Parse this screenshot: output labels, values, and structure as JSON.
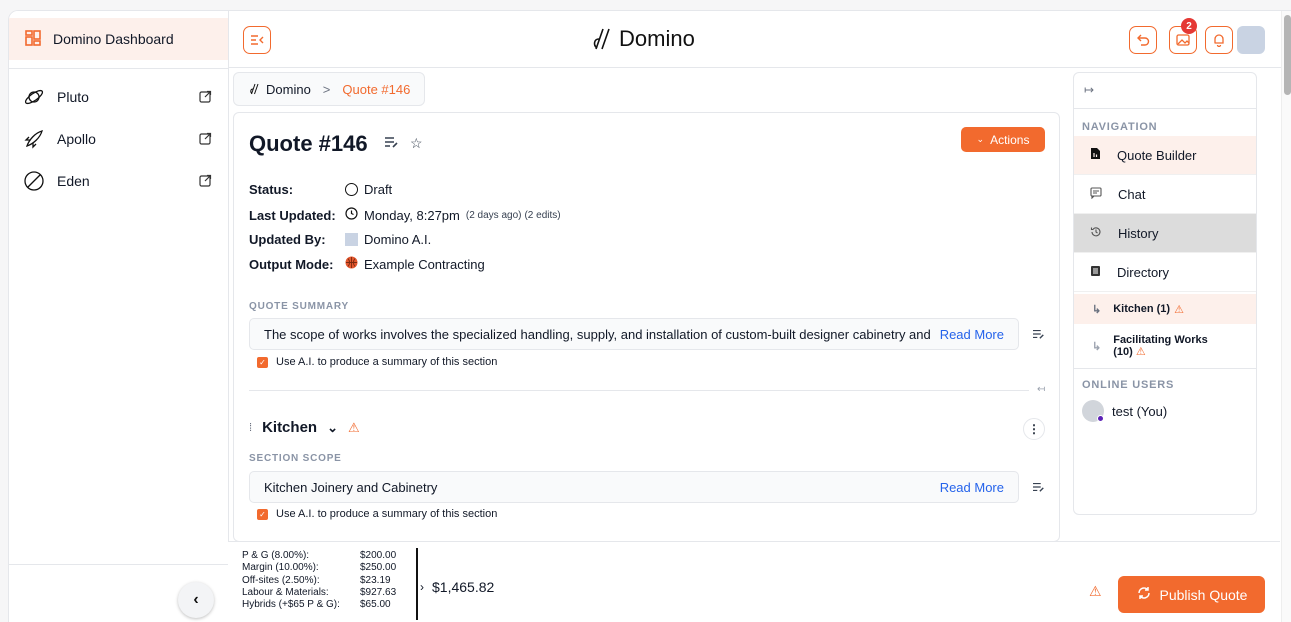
{
  "sidebar": {
    "dashboard_label": "Domino Dashboard",
    "items": [
      {
        "label": "Pluto",
        "icon": "planet-icon"
      },
      {
        "label": "Apollo",
        "icon": "rocket-icon"
      },
      {
        "label": "Eden",
        "icon": "slashed-circle-icon"
      }
    ]
  },
  "header": {
    "brand": "Domino",
    "notification_count": "2"
  },
  "breadcrumb": {
    "home": "Domino",
    "separator": ">",
    "current": "Quote #146"
  },
  "quote": {
    "title": "Quote #146",
    "actions_label": "Actions",
    "status_label": "Status:",
    "status_value": "Draft",
    "last_updated_label": "Last Updated:",
    "last_updated_value": "Monday, 8:27pm",
    "last_updated_ago": "(2 days ago)",
    "last_updated_edits": "(2 edits)",
    "updated_by_label": "Updated By:",
    "updated_by_value": "Domino A.I.",
    "output_mode_label": "Output Mode:",
    "output_mode_value": "Example Contracting",
    "summary_heading": "QUOTE SUMMARY",
    "summary_text": "The scope of works involves the specialized handling, supply, and installation of custom-built designer cabinetry and",
    "read_more": "Read More",
    "ai_summary_label": "Use A.I. to produce a summary of this section"
  },
  "section": {
    "title": "Kitchen",
    "scope_heading": "SECTION SCOPE",
    "scope_text": "Kitchen Joinery and Cabinetry",
    "read_more": "Read More",
    "ai_summary_label": "Use A.I. to produce a summary of this section"
  },
  "rightnav": {
    "navigation_heading": "NAVIGATION",
    "items": [
      {
        "label": "Quote Builder"
      },
      {
        "label": "Chat"
      },
      {
        "label": "History"
      },
      {
        "label": "Directory"
      }
    ],
    "sub_items": [
      {
        "label": "Kitchen (1)"
      },
      {
        "label_line1": "Facilitating Works",
        "label_line2": "(10)"
      }
    ],
    "online_heading": "ONLINE USERS",
    "user": "test (You)"
  },
  "footer": {
    "costs": [
      {
        "label": "P & G (8.00%):",
        "value": "$200.00"
      },
      {
        "label": "Margin (10.00%):",
        "value": "$250.00"
      },
      {
        "label": "Off-sites (2.50%):",
        "value": "$23.19"
      },
      {
        "label": "Labour & Materials:",
        "value": "$927.63"
      },
      {
        "label": "Hybrids (+$65 P & G):",
        "value": "$65.00"
      }
    ],
    "total": "$1,465.82",
    "publish_label": "Publish Quote"
  },
  "colors": {
    "accent": "#f26a2e",
    "link": "#2563eb",
    "active_bg": "#fdf0eb"
  }
}
